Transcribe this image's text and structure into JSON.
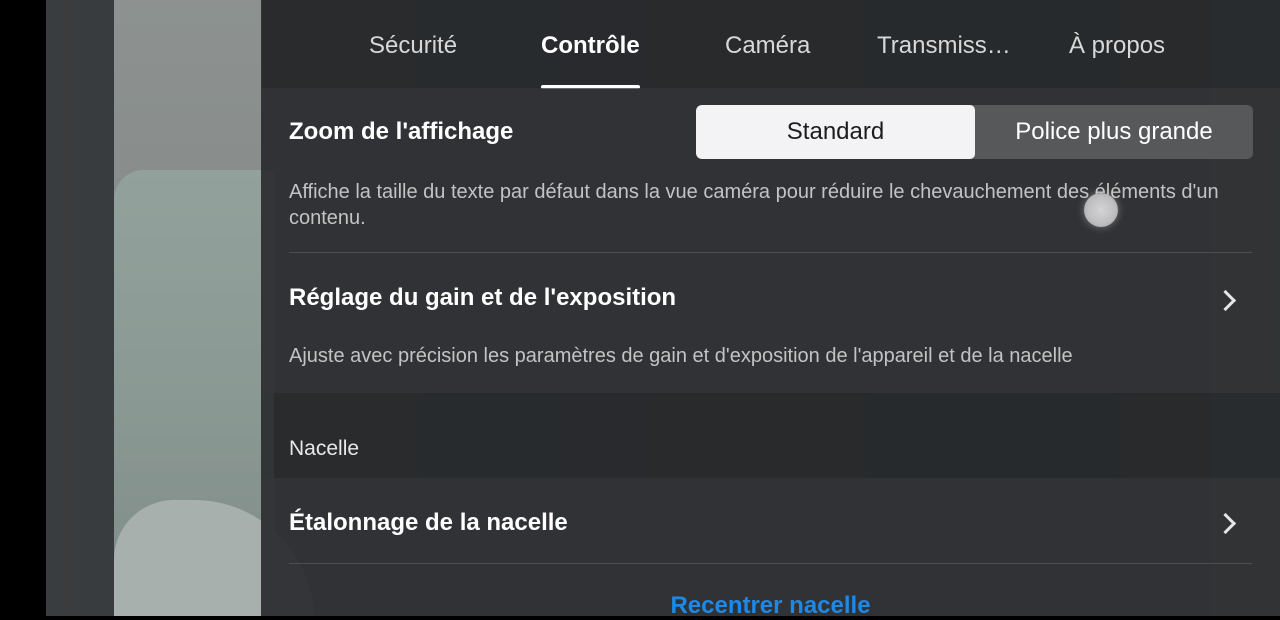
{
  "tabs": [
    {
      "label": "Sécurité",
      "active": false
    },
    {
      "label": "Contrôle",
      "active": true
    },
    {
      "label": "Caméra",
      "active": false
    },
    {
      "label": "Transmiss…",
      "active": false
    },
    {
      "label": "À propos",
      "active": false
    }
  ],
  "display_zoom": {
    "title": "Zoom de l'affichage",
    "options": [
      "Standard",
      "Police plus grande"
    ],
    "selected": "Standard",
    "description": "Affiche la taille du texte par défaut dans la vue caméra pour réduire le chevauchement des éléments d'un contenu."
  },
  "gain_exposure": {
    "title": "Réglage du gain et de l'exposition",
    "description": "Ajuste avec précision les paramètres de gain et d'exposition de l'appareil et de la nacelle"
  },
  "gimbal_section": {
    "header": "Nacelle",
    "calibration_title": "Étalonnage de la nacelle",
    "recenter_label": "Recentrer nacelle"
  },
  "colors": {
    "accent": "#1e88e5",
    "panel": "#2a2c2e",
    "selected_segment": "#f3f3f5"
  },
  "icons": [
    "chevron-right-icon"
  ]
}
